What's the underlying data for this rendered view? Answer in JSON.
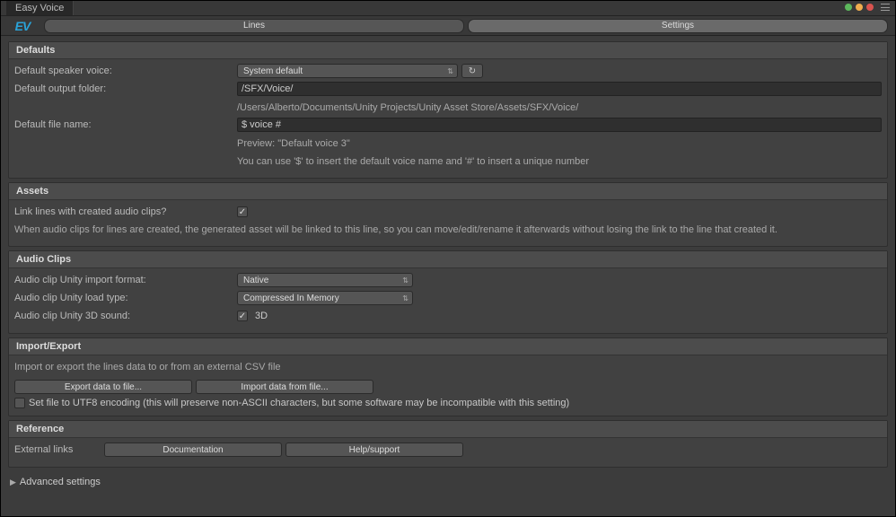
{
  "window": {
    "title": "Easy Voice"
  },
  "tabs": {
    "lines": "Lines",
    "settings": "Settings",
    "active": "settings"
  },
  "sections": {
    "defaults": {
      "title": "Defaults",
      "speaker_label": "Default speaker voice:",
      "speaker_value": "System default",
      "folder_label": "Default output folder:",
      "folder_value": "/SFX/Voice/",
      "folder_resolved": "/Users/Alberto/Documents/Unity Projects/Unity Asset Store/Assets/SFX/Voice/",
      "filename_label": "Default file name:",
      "filename_value": "$ voice #",
      "filename_preview": "Preview: \"Default voice 3\"",
      "filename_hint": "You can use '$' to insert the default voice name and '#' to insert a unique number"
    },
    "assets": {
      "title": "Assets",
      "link_label": "Link lines with created audio clips?",
      "link_checked": true,
      "link_desc": "When audio clips for lines are created, the generated asset will be linked to this line, so you can move/edit/rename it afterwards without losing the link to the line that created it."
    },
    "audioClips": {
      "title": "Audio Clips",
      "format_label": "Audio clip Unity import format:",
      "format_value": "Native",
      "load_label": "Audio clip Unity load type:",
      "load_value": "Compressed In Memory",
      "sound_label": "Audio clip Unity 3D sound:",
      "sound_checked": true,
      "sound_text": "3D"
    },
    "importExport": {
      "title": "Import/Export",
      "desc": "Import or export the lines data to or from an external CSV file",
      "export_btn": "Export data to file...",
      "import_btn": "Import data from file...",
      "utf8_checked": false,
      "utf8_label": "Set file to UTF8 encoding (this will preserve non-ASCII characters, but some software may be incompatible with this setting)"
    },
    "reference": {
      "title": "Reference",
      "links_label": "External links",
      "doc_btn": "Documentation",
      "help_btn": "Help/support"
    }
  },
  "advanced": {
    "label": "Advanced settings"
  }
}
